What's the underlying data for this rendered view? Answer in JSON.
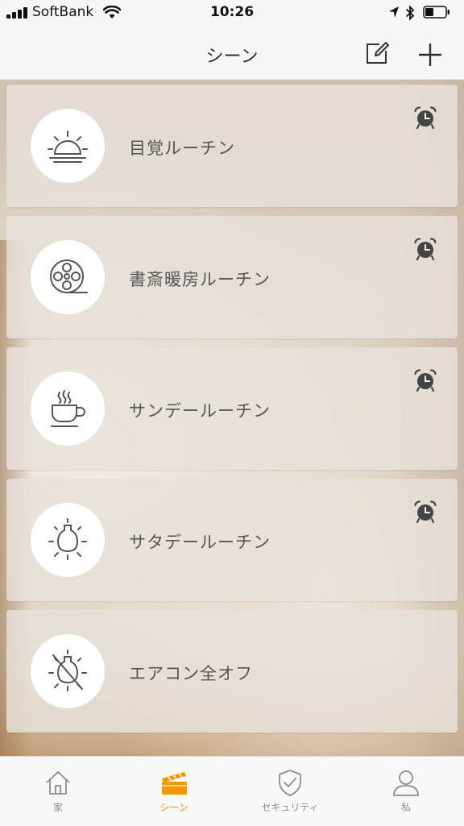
{
  "status_bar": {
    "carrier": "SoftBank",
    "time": "10:26"
  },
  "nav": {
    "title": "シーン",
    "edit_icon": "edit-icon",
    "add_icon": "plus-icon"
  },
  "scenes": [
    {
      "name": "目覚ルーチン",
      "icon": "sunrise-icon",
      "has_alarm": true
    },
    {
      "name": "書斎暖房ルーチン",
      "icon": "film-reel-icon",
      "has_alarm": true
    },
    {
      "name": "サンデールーチン",
      "icon": "coffee-cup-icon",
      "has_alarm": true
    },
    {
      "name": "サタデールーチン",
      "icon": "bulb-on-icon",
      "has_alarm": true
    },
    {
      "name": "エアコン全オフ",
      "icon": "bulb-off-icon",
      "has_alarm": false
    }
  ],
  "tabs": [
    {
      "label": "家",
      "icon": "home-icon",
      "active": false
    },
    {
      "label": "シーン",
      "icon": "clapperboard-icon",
      "active": true
    },
    {
      "label": "セキュリティ",
      "icon": "shield-check-icon",
      "active": false
    },
    {
      "label": "私",
      "icon": "person-icon",
      "active": false
    }
  ],
  "colors": {
    "accent": "#f39800",
    "icon_gray": "#555555",
    "alarm_gray": "#444444"
  }
}
